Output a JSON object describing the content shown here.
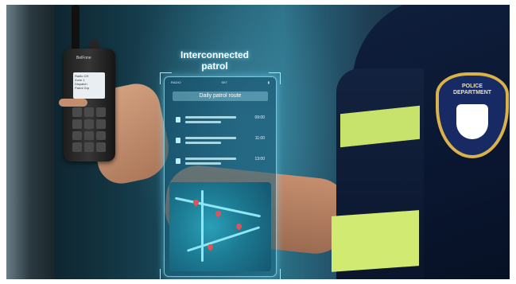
{
  "hologram": {
    "title": "Interconnected patrol",
    "route_label": "Daily patrol route",
    "status_left": "RADIO",
    "status_center": "SKT",
    "entries": [
      {
        "time": "09:00"
      },
      {
        "time": "11:00"
      },
      {
        "time": "13:00"
      }
    ]
  },
  "radio": {
    "brand": "BelFone",
    "screen_lines": [
      "Radio CH",
      "Zone 1",
      "Dispatch",
      "Patrol Grp"
    ]
  },
  "badge": {
    "text_top": "POLICE DEPARTMENT"
  },
  "colors": {
    "hologram_glow": "#8fe6f5",
    "vest_stripe": "#c7e36c",
    "uniform": "#0f1f3d",
    "badge_trim": "#d9b24a"
  }
}
